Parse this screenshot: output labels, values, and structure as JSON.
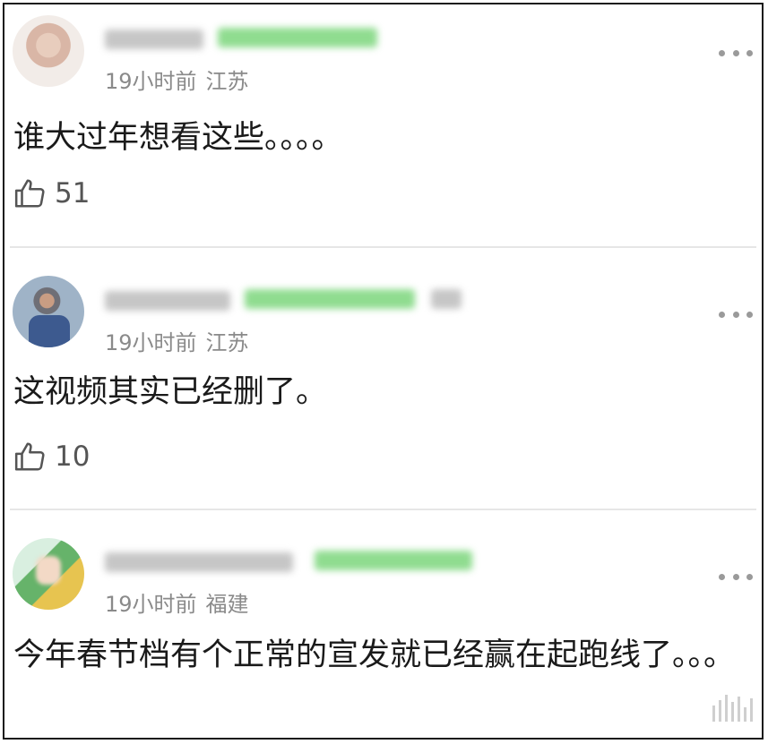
{
  "comments": [
    {
      "time": "19小时前",
      "location": "江苏",
      "text": "谁大过年想看这些。。。。",
      "likes": "51",
      "colors": {
        "text": "#1a1a1a",
        "meta": "#8a8a8a"
      }
    },
    {
      "time": "19小时前",
      "location": "江苏",
      "text": "这视频其实已经删了。",
      "likes": "10",
      "colors": {
        "text": "#1a1a1a",
        "meta": "#8a8a8a"
      }
    },
    {
      "time": "19小时前",
      "location": "福建",
      "text": "今年春节档有个正常的宣发就已经赢在起跑线了。。。",
      "colors": {
        "text": "#1a1a1a",
        "meta": "#8a8a8a"
      }
    }
  ],
  "icons": {
    "more": "more-dots-icon",
    "like": "thumbs-up-icon"
  },
  "colors": {
    "border": "#1a1a1a",
    "divider": "#e6e6e6",
    "blur_gray": "#c6c6c6",
    "blur_green": "#8fdc8f"
  }
}
